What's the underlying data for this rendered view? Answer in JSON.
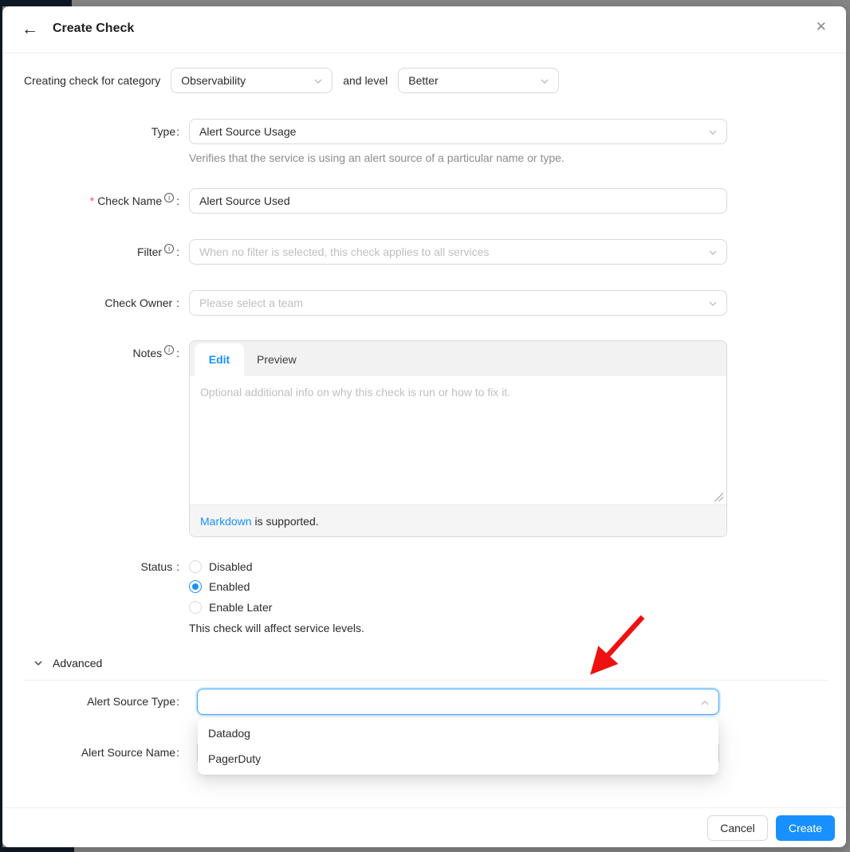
{
  "colors": {
    "accent": "#1890ff",
    "focus_border": "#40a9ff",
    "required": "#ff4d4f",
    "annotation_arrow": "#ee1111",
    "field_border": "#d9d9d9",
    "backdrop_dark": "#0e1a26",
    "backdrop_gray": "#868686"
  },
  "header": {
    "back_icon": "←",
    "title": "Create Check",
    "close_icon": "✕"
  },
  "category_row": {
    "prefix": "Creating check for category",
    "category_value": "Observability",
    "middle": "and level",
    "level_value": "Better"
  },
  "form": {
    "required_marker": "*",
    "info_icon": "i",
    "colon": ":",
    "type": {
      "label": "Type",
      "value": "Alert Source Usage",
      "help": "Verifies that the service is using an alert source of a particular name or type."
    },
    "check_name": {
      "label": "Check Name",
      "value": "Alert Source Used"
    },
    "filter": {
      "label": "Filter",
      "placeholder": "When no filter is selected, this check applies to all services"
    },
    "check_owner": {
      "label": "Check Owner",
      "placeholder": "Please select a team"
    },
    "notes": {
      "label": "Notes",
      "tabs": [
        {
          "label": "Edit"
        },
        {
          "label": "Preview"
        }
      ],
      "placeholder": "Optional additional info on why this check is run or how to fix it.",
      "footer_link": "Markdown",
      "footer_rest": " is supported."
    },
    "status": {
      "label": "Status",
      "options": [
        {
          "label": "Disabled",
          "selected": false
        },
        {
          "label": "Enabled",
          "selected": true
        },
        {
          "label": "Enable Later",
          "selected": false
        }
      ],
      "note": "This check will affect service levels."
    },
    "advanced": {
      "label": "Advanced"
    },
    "alert_source_type": {
      "label": "Alert Source Type",
      "value": "",
      "options": [
        {
          "label": "Datadog"
        },
        {
          "label": "PagerDuty"
        }
      ]
    },
    "alert_source_name": {
      "label": "Alert Source Name"
    }
  },
  "footer": {
    "cancel_label": "Cancel",
    "create_label": "Create"
  }
}
